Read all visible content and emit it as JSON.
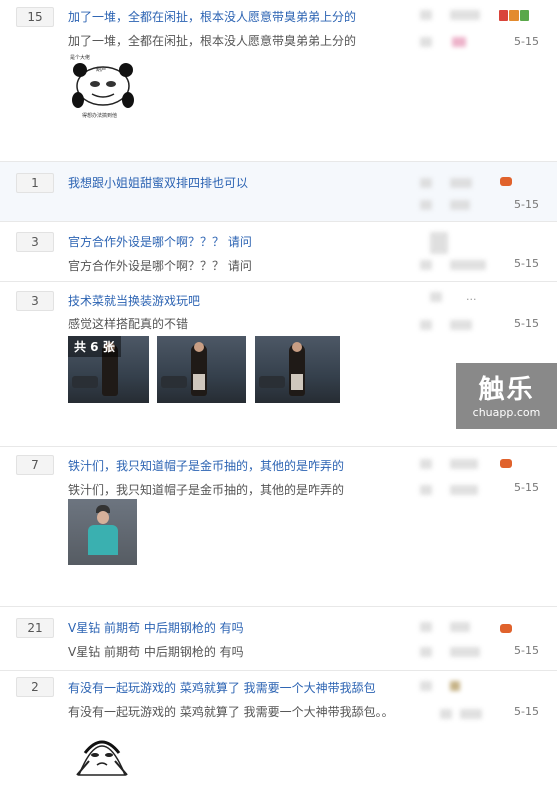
{
  "threads": [
    {
      "count": "15",
      "title": "加了一堆，全都在闲扯，根本没人愿意带臭弟弟上分的",
      "summary": "加了一堆，全都在闲扯，根本没人愿意带臭弟弟上分的",
      "time": "5-15",
      "meme_top": "是个大佬",
      "meme_face": "葫芦",
      "meme_bottom": "得想办法搞到他"
    },
    {
      "count": "1",
      "title": "我想跟小姐姐甜蜜双排四排也可以",
      "summary": "",
      "time": "5-15"
    },
    {
      "count": "3",
      "title": "官方合作外设是哪个啊？？？ 请问",
      "summary": "官方合作外设是哪个啊？？？ 请问",
      "time": "5-15"
    },
    {
      "count": "3",
      "title": "技术菜就当换装游戏玩吧",
      "summary": "感觉这样搭配真的不错",
      "time": "5-15",
      "photo_overlay": "共 6 张",
      "dots": "..."
    },
    {
      "count": "7",
      "title": "铁汁们，我只知道帽子是金币抽的，其他的是咋弄的",
      "summary": "铁汁们，我只知道帽子是金币抽的，其他的是咋弄的",
      "time": "5-15"
    },
    {
      "count": "21",
      "title": "V星钻 前期苟 中后期钢枪的 有吗",
      "summary": "V星钻 前期苟 中后期钢枪的 有吗",
      "time": "5-15"
    },
    {
      "count": "2",
      "title": "有没有一起玩游戏的 菜鸡就算了 我需要一个大神带我舔包",
      "summary": "有没有一起玩游戏的 菜鸡就算了 我需要一个大神带我舔包。。",
      "time": "5-15"
    }
  ],
  "watermark": {
    "main": "触乐",
    "sub": "chuapp.com"
  },
  "colors": {
    "link": "#2d64b3",
    "highlight": "#f5f8fc"
  }
}
